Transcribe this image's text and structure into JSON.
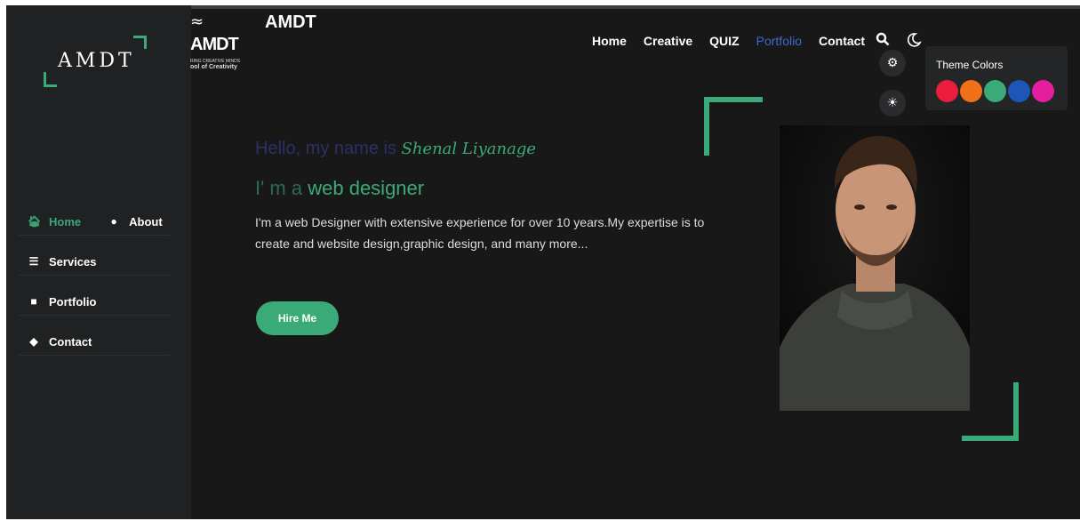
{
  "sidebar": {
    "logo": "AMDT",
    "items": [
      {
        "label": "Home",
        "icon": "home-icon"
      },
      {
        "label": "About",
        "icon": "user-icon"
      },
      {
        "label": "Services",
        "icon": "list-icon"
      },
      {
        "label": "Portfolio",
        "icon": "briefcase-icon"
      },
      {
        "label": "Contact",
        "icon": "comments-icon"
      }
    ]
  },
  "header": {
    "brand_mark": "AMDT",
    "brand_tagline": "RING CREATIVE MINDS",
    "brand_school": "ool of Creativity",
    "title": "AMDT",
    "nav": [
      "Home",
      "Creative",
      "QUIZ",
      "Portfolio",
      "Contact"
    ],
    "active_nav": "Portfolio"
  },
  "theme_panel": {
    "title": "Theme Colors",
    "colors": [
      "#ec1c3e",
      "#f1711a",
      "#3aaa78",
      "#1e56b8",
      "#e51ea0"
    ]
  },
  "hero": {
    "hello_prefix": "Hello, my name is",
    "name": "Shenal Liyanage",
    "role_prefix": "I' m a",
    "role": "web designer",
    "description": "I'm a web Designer with extensive experience for over 10 years.My expertise is to create and website design,graphic design, and many more...",
    "cta": "Hire Me"
  },
  "colors": {
    "accent": "#3aaa78",
    "background": "#181818",
    "sidebar": "#202122",
    "active_link": "#3d6bd1"
  }
}
